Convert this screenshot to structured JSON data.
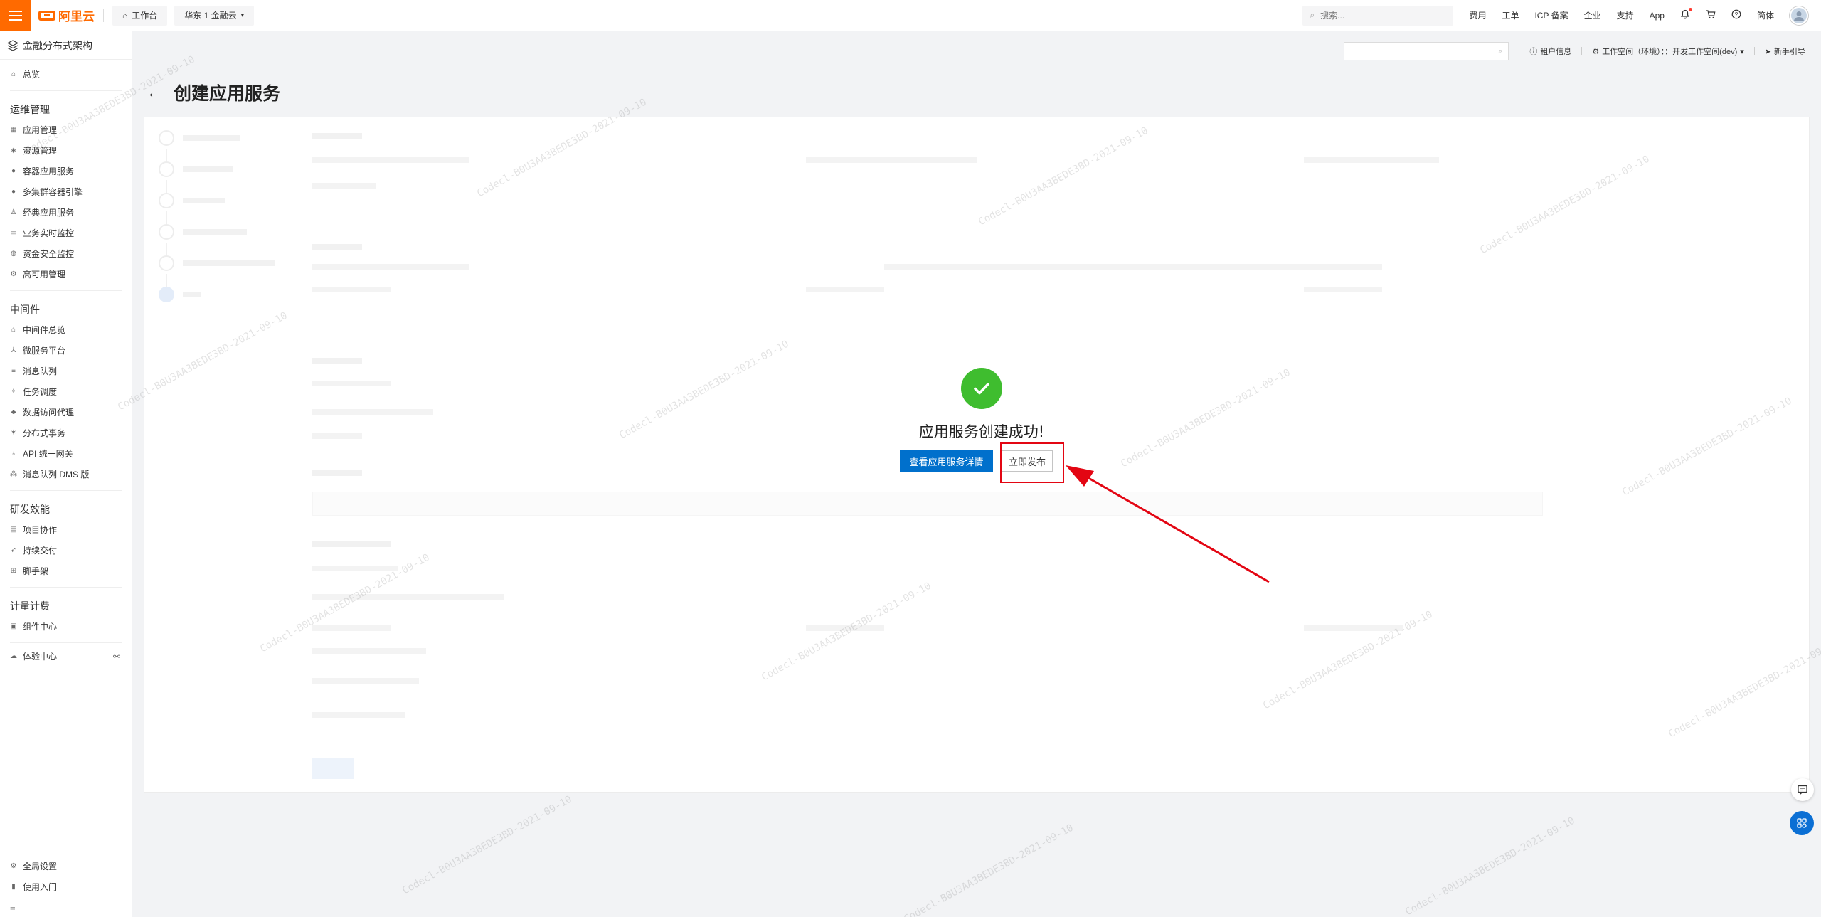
{
  "topbar": {
    "brand": "阿里云",
    "workbench": "工作台",
    "region": "华东 1 金融云",
    "search_placeholder": "搜索...",
    "links": [
      "费用",
      "工单",
      "ICP 备案",
      "企业",
      "支持",
      "App"
    ],
    "language": "简体"
  },
  "sidebar": {
    "product_title": "金融分布式架构",
    "overview": "总览",
    "groups": [
      {
        "title": "运维管理",
        "items": [
          "应用管理",
          "资源管理",
          "容器应用服务",
          "多集群容器引擎",
          "经典应用服务",
          "业务实时监控",
          "资金安全监控",
          "高可用管理"
        ]
      },
      {
        "title": "中间件",
        "items": [
          "中间件总览",
          "微服务平台",
          "消息队列",
          "任务调度",
          "数据访问代理",
          "分布式事务",
          "API 统一网关",
          "消息队列 DMS 版"
        ]
      },
      {
        "title": "研发效能",
        "items": [
          "项目协作",
          "持续交付",
          "脚手架"
        ]
      },
      {
        "title": "计量计费",
        "items": [
          "组件中心"
        ]
      }
    ],
    "experience": "体验中心",
    "bottom_items": [
      "全局设置",
      "使用入门"
    ]
  },
  "toolbar": {
    "tenant": "租户信息",
    "workspace": "工作空间（环境）：：开发工作空间(dev)",
    "guide": "新手引导"
  },
  "page": {
    "title": "创建应用服务"
  },
  "success": {
    "message": "应用服务创建成功!",
    "view_button": "查看应用服务详情",
    "publish_button": "立即发布"
  },
  "watermark": "Codecl-B0U3AA3BEDE3BD-2021-09-10",
  "colors": {
    "brand": "#ff6a00",
    "primary": "#0070cc",
    "success": "#3fbd2f",
    "annotation_red": "#e30613"
  }
}
